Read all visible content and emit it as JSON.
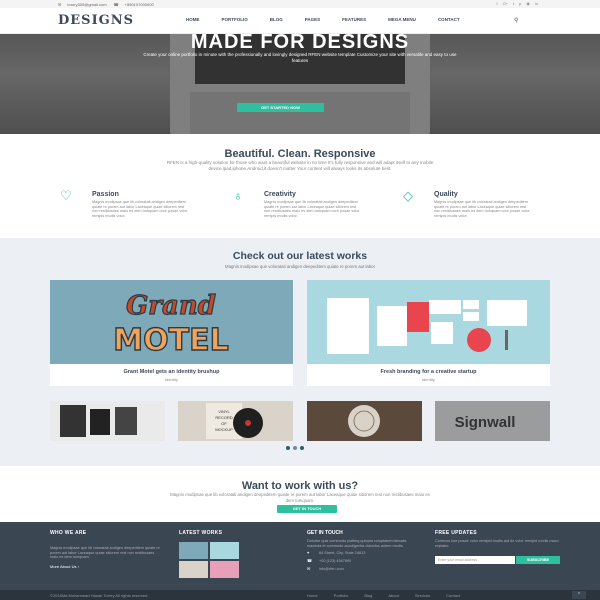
{
  "topbar": {
    "email": "torory300@gmail.com",
    "phone": "+880107000000",
    "social_icons": [
      "facebook-icon",
      "google-plus-icon",
      "twitter-icon",
      "pinterest-icon",
      "rss-icon",
      "linkedin-icon"
    ]
  },
  "nav": {
    "logo": "DESIGNS",
    "items": [
      "HOME",
      "PORTFOLIO",
      "BLOG",
      "PAGES",
      "FEATURES",
      "MEGA MENU",
      "CONTACT"
    ]
  },
  "hero": {
    "title": "MADE FOR DESIGNS",
    "subtitle": "Create your online portfolio in minute with the professionally and lovingly designed RFEN website template Customize your site with versatile and easy to use features",
    "button": "GET STARTED NOW"
  },
  "intro": {
    "title": "Beautiful. Clean. Responsive",
    "text": "RFEN is a high-quality solution for those who want a beautiful website in no time It's fully responsive and will adapt itself to any mobile device,ipad,iphone,Android,it doesn't matter Your content will always looks its absolute best."
  },
  "features": [
    {
      "title": "Passion",
      "icon": "heart-icon",
      "text": "Magnis modipsae que lib voloratati andigen deepeditem quiate re porem aut labor Laceaque quiae sitiorem rest non restibusaes maio es dem tumquam core posae volor remipis modis volor."
    },
    {
      "title": "Creativity",
      "icon": "lightbulb-icon",
      "text": "Magnis modipsae que lib voloratati andigen deepeditem quiate re porem aut labor Laceaque quiae sitiorem rest non restibusaes maio es dem tumquam core posae volor remipis modis volor."
    },
    {
      "title": "Quality",
      "icon": "diamond-icon",
      "text": "Magnis modipsae que lib voloratati andigen deepeditem quiate re porem aut labor Laceaque quiae sitiorem rest non restibusaes maio es dem tumquam core posae volor remipis modis volor."
    }
  ],
  "works": {
    "title": "Check out our latest works",
    "subtitle": "Magnis modipsae que voloratati andigen deepeditem quiate re porem aut labor",
    "cards": [
      {
        "title": "Grant Motel gets an identity brushup",
        "category": "identity",
        "art_line1": "Grand",
        "art_line2": "MOTEL"
      },
      {
        "title": "Fresh branding for a creative startup",
        "category": "identity"
      }
    ],
    "thumb_text": [
      "VINYL",
      "RECORD",
      "OF",
      "MOCKUP",
      "Signwall"
    ]
  },
  "cta": {
    "title": "Want to work with us?",
    "text": "Magnis modipsae que lib voloratati andigen deepeditem quiate re porem aut labor Laceaque quiae sitiorem rest non restibusaes maio es dem tumquam.",
    "button": "GET IN TOUCH"
  },
  "footer": {
    "who_title": "WHO WE ARE",
    "who_text": "Magnis modipsae que lib voloratati andigen deepeditem quiate re porem aut labor Laceaque quiae sitiorem rest non restibusaes maio es dem tumquam.",
    "more": "More About Us ›",
    "latest_title": "LATEST WORKS",
    "touch_title": "GET IN TOUCH",
    "touch_text": "Dolorbe quis commodo platting quiopta voluptatem laboalis maxinda et commodo accullgentia dolontus autem modis.",
    "address": "84 Street, City, State 24813",
    "phone": "+00 (123) 4567890",
    "email": "info@rfen.com",
    "updates_title": "FREE UPDATES",
    "updates_text": "Conecus iure posae volor remipid modis aut de volor remipid modis maxo explabo.",
    "email_placeholder": "Enter your email address",
    "subscribe": "SUBSCRIBE"
  },
  "bottom": {
    "copy": "©2016Md.Mohammad Hasan Torrey All rights reserved.",
    "links": [
      "Home",
      "Portfolio",
      "Blog",
      "About",
      "Services",
      "Contact"
    ]
  }
}
